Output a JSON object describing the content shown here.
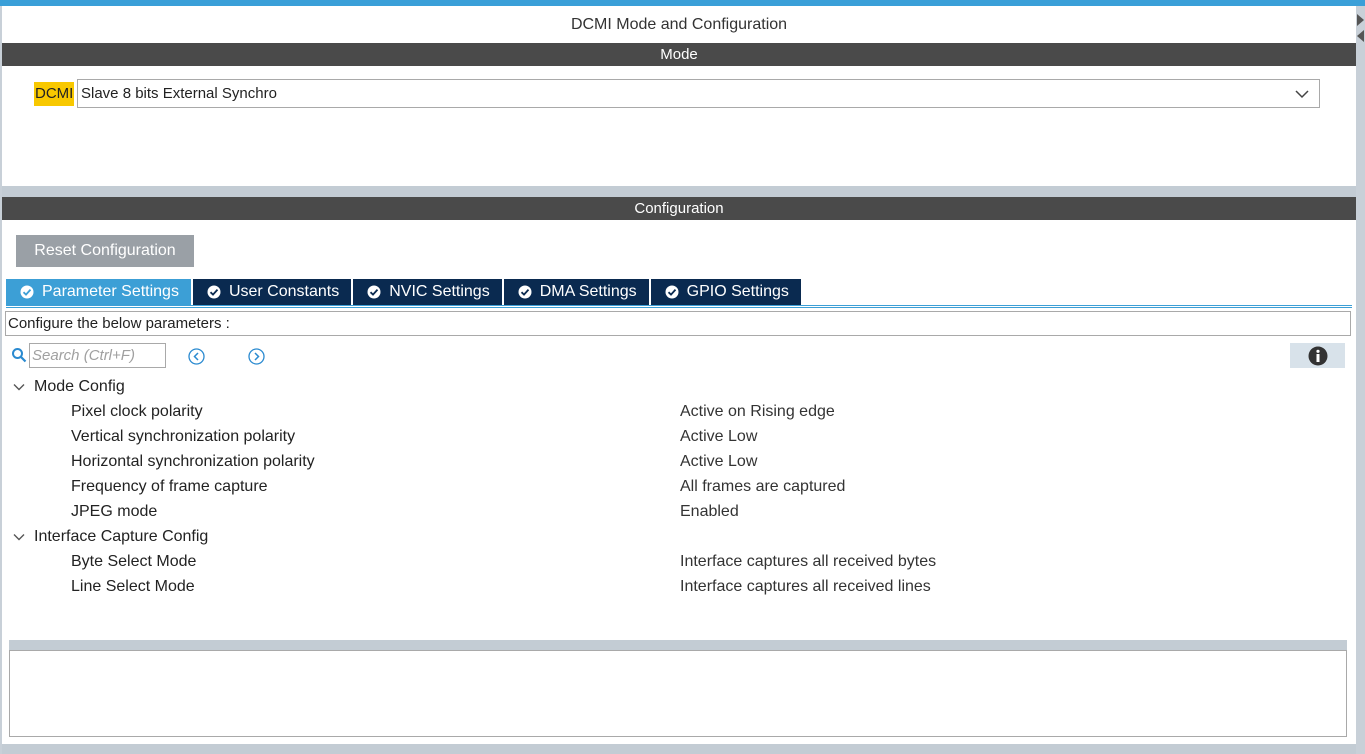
{
  "window": {
    "title": "DCMI Mode and Configuration"
  },
  "mode_section": {
    "header": "Mode",
    "label": "DCMI",
    "selected_value": "Slave 8 bits External Synchro"
  },
  "config_section": {
    "header": "Configuration",
    "reset_label": "Reset Configuration",
    "tabs": [
      {
        "label": "Parameter Settings",
        "active": true
      },
      {
        "label": "User Constants",
        "active": false
      },
      {
        "label": "NVIC Settings",
        "active": false
      },
      {
        "label": "DMA Settings",
        "active": false
      },
      {
        "label": "GPIO Settings",
        "active": false
      }
    ],
    "description": "Configure the below parameters :",
    "search": {
      "placeholder": "Search (Ctrl+F)",
      "value": ""
    }
  },
  "parameters": {
    "groups": [
      {
        "name": "Mode Config",
        "items": [
          {
            "name": "Pixel clock polarity",
            "value": "Active on Rising edge"
          },
          {
            "name": "Vertical synchronization polarity",
            "value": "Active Low"
          },
          {
            "name": "Horizontal synchronization polarity",
            "value": "Active Low"
          },
          {
            "name": "Frequency of frame capture",
            "value": "All frames are captured"
          },
          {
            "name": "JPEG mode",
            "value": "Enabled"
          }
        ]
      },
      {
        "name": "Interface Capture Config",
        "items": [
          {
            "name": "Byte Select Mode",
            "value": "Interface captures all received bytes"
          },
          {
            "name": "Line Select Mode",
            "value": "Interface captures all received lines"
          }
        ]
      }
    ]
  },
  "colors": {
    "accent": "#3c9fd6",
    "tab_inactive": "#0a2a50",
    "section_header": "#4a4a4a",
    "highlight": "#f8c800",
    "button_disabled": "#9aa0a6"
  },
  "icons": {
    "search": "search-icon",
    "prev": "previous-circle-icon",
    "next": "next-circle-icon",
    "info": "info-icon",
    "tab_check": "check-circle-icon",
    "dropdown": "chevron-down-icon",
    "tree_toggle": "chevron-down-icon"
  }
}
